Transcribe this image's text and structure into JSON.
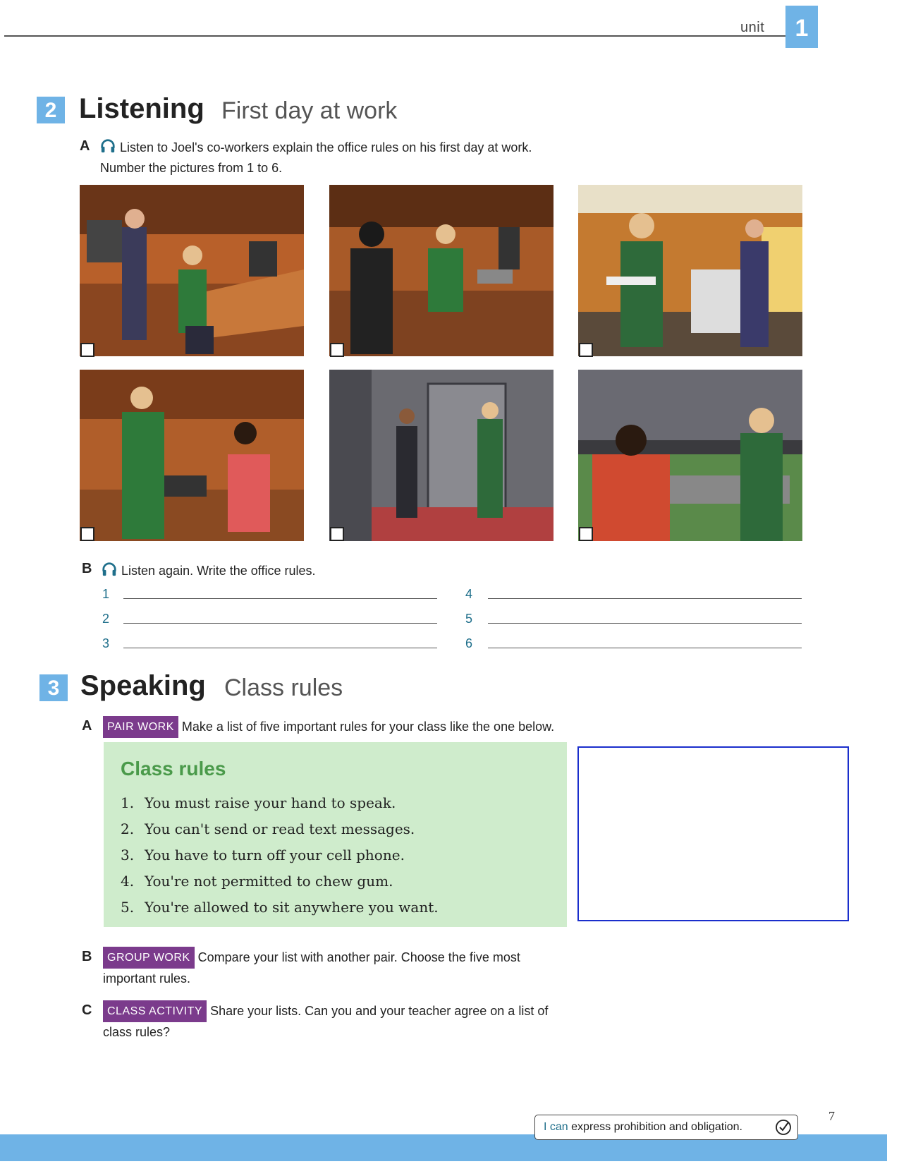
{
  "header": {
    "unit_label": "unit",
    "unit_number": "1"
  },
  "listening": {
    "number": "2",
    "title": "Listening",
    "subtitle": "First day at work",
    "a": {
      "letter": "A",
      "line1": "Listen to Joel's co-workers explain the office rules on his first day at work.",
      "line2": "Number the pictures from 1 to 6."
    },
    "pictures": [
      {
        "scene": "woman-speaking-to-man-at-computer-desk"
      },
      {
        "scene": "woman-handing-coffee-to-man-at-desk"
      },
      {
        "scene": "man-with-papers-near-photocopier"
      },
      {
        "scene": "man-at-cubicle-with-woman-in-red"
      },
      {
        "scene": "men-at-glass-office-door"
      },
      {
        "scene": "two-men-in-office-kitchen"
      }
    ],
    "b": {
      "letter": "B",
      "instruction": "Listen again. Write the office rules.",
      "numbers": [
        "1",
        "2",
        "3",
        "4",
        "5",
        "6"
      ]
    }
  },
  "speaking": {
    "number": "3",
    "title": "Speaking",
    "subtitle": "Class rules",
    "a": {
      "letter": "A",
      "tag": "PAIR WORK",
      "text": "Make a list of five important rules for your class like the one below."
    },
    "rules_card": {
      "title": "Class rules",
      "items": [
        {
          "n": "1.",
          "text": "You must raise your hand to speak."
        },
        {
          "n": "2.",
          "text": "You can't send or read text messages."
        },
        {
          "n": "3.",
          "text": "You have to turn off your cell phone."
        },
        {
          "n": "4.",
          "text": "You're not permitted to chew gum."
        },
        {
          "n": "5.",
          "text": "You're allowed to sit anywhere you want."
        }
      ]
    },
    "b": {
      "letter": "B",
      "tag": "GROUP WORK",
      "line1": "Compare your list with another pair. Choose the five most",
      "line2": "important rules."
    },
    "c": {
      "letter": "C",
      "tag": "CLASS ACTIVITY",
      "line1": "Share your lists. Can you and your teacher agree on a list of",
      "line2": "class rules?"
    }
  },
  "footer": {
    "i_can": "I can",
    "statement": "express prohibition and obligation.",
    "page_number": "7"
  },
  "colors": {
    "accent_blue": "#6fb3e6",
    "tag_purple": "#7b3b8c",
    "rules_green": "#cfeccc",
    "rules_title": "#4a9a4a"
  }
}
